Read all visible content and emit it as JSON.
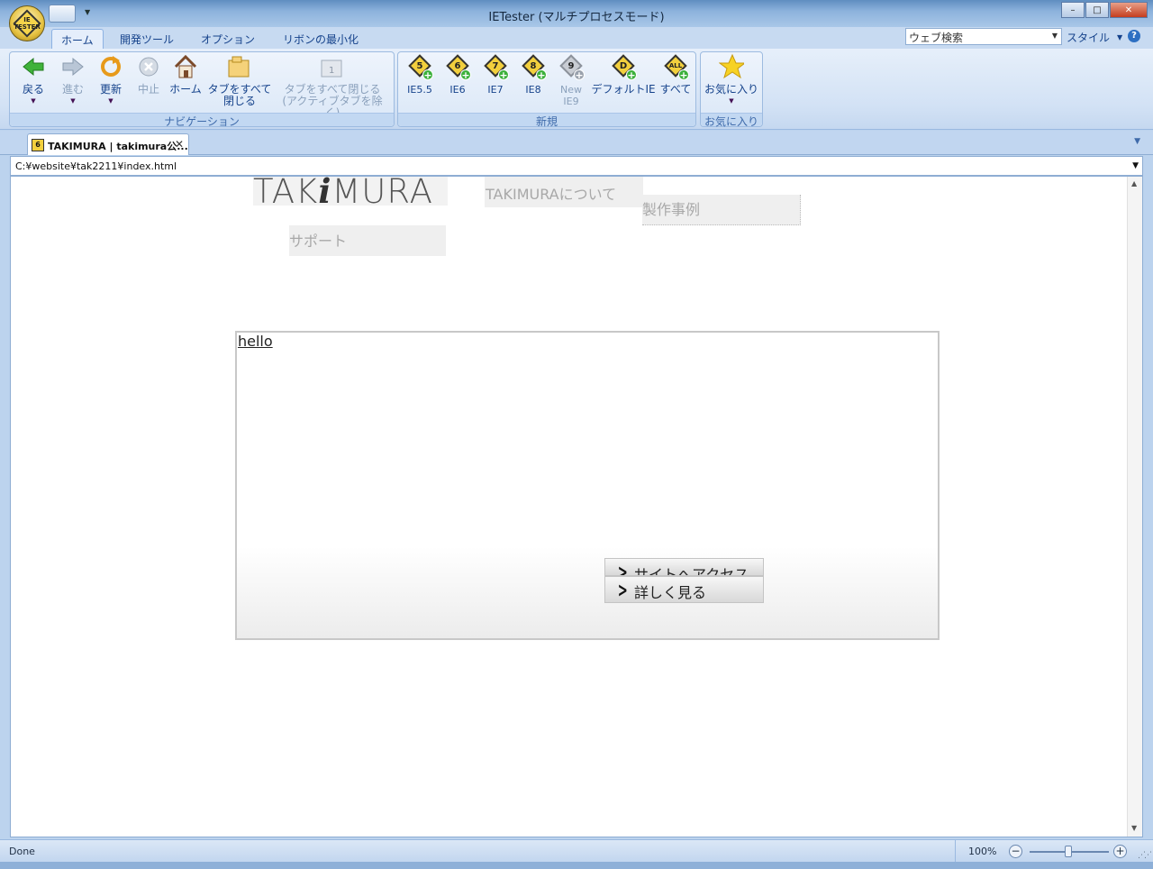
{
  "window": {
    "title": "IETester (マルチプロセスモード)",
    "orb_text": "IE TESTER",
    "min": "–",
    "max": "□",
    "close": "✕"
  },
  "ribbon_tabs": [
    "ホーム",
    "開発ツール",
    "オプション",
    "リボンの最小化"
  ],
  "search": {
    "value": "ウェブ検索"
  },
  "style_label": "スタイル",
  "help_label": "?",
  "navigation_group": {
    "label": "ナビゲーション",
    "back": "戻る",
    "forward": "進む",
    "refresh": "更新",
    "stop": "中止",
    "home": "ホーム",
    "close_all_line1": "タブをすべて",
    "close_all_line2": "閉じる",
    "close_others_line1": "タブをすべて閉じる",
    "close_others_line2": "(アクティブタブを除く)"
  },
  "new_group": {
    "label": "新規",
    "ie55": "IE5.5",
    "ie6": "IE6",
    "ie7": "IE7",
    "ie8": "IE8",
    "ie9_line1": "New",
    "ie9_line2": "IE9",
    "default_ie": "デフォルトIE",
    "all": "すべて",
    "icon_55": "5",
    "icon_6": "6",
    "icon_7": "7",
    "icon_8": "8",
    "icon_9": "9",
    "icon_d": "D",
    "icon_all": "ALL"
  },
  "favorites_group": {
    "label": "お気に入り",
    "button": "お気に入り"
  },
  "doc_tab": {
    "title": "TAKIMURA | takimura公...",
    "icon_num": "6"
  },
  "address": {
    "value": "C:¥website¥tak2211¥index.html"
  },
  "page": {
    "logo_a": "TAK",
    "logo_i": "i",
    "logo_b": "MURA",
    "nav_about": "TAKIMURAについて",
    "nav_works": "製作事例",
    "nav_support": "サポート",
    "hello": "hello",
    "cta_site": "サイトへアクセス",
    "cta_more": "詳しく見る"
  },
  "status": {
    "text": "Done",
    "zoom": "100%",
    "zoom_level_fraction": 0.45
  },
  "colors": {
    "ribbon_text": "#15428b",
    "ie_icon": "#f2cf3d",
    "add_green": "#3bb03b"
  }
}
